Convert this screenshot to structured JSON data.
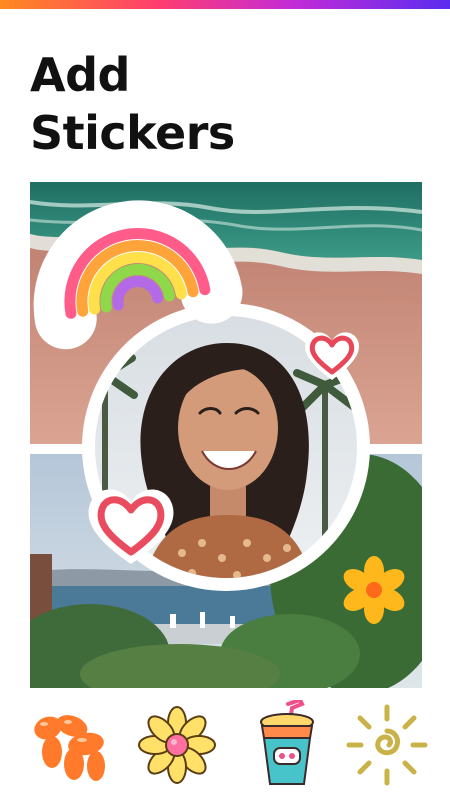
{
  "header": {
    "title_line1": "Add",
    "title_line2": "Stickers"
  },
  "colors": {
    "accent_gradient": [
      "#ff8a1f",
      "#ff3d6e",
      "#c42bd8",
      "#5a2cf0"
    ],
    "title_text": "#111111",
    "background": "#ffffff"
  },
  "canvas_stickers": [
    {
      "icon": "rainbow-sticker"
    },
    {
      "icon": "heart-sticker-small"
    },
    {
      "icon": "heart-sticker-large"
    },
    {
      "icon": "orange-flower-sticker"
    }
  ],
  "sticker_tray": [
    {
      "icon": "balloon-dog-sticker"
    },
    {
      "icon": "daisy-sticker"
    },
    {
      "icon": "iced-drink-sticker"
    },
    {
      "icon": "sun-sticker"
    }
  ]
}
